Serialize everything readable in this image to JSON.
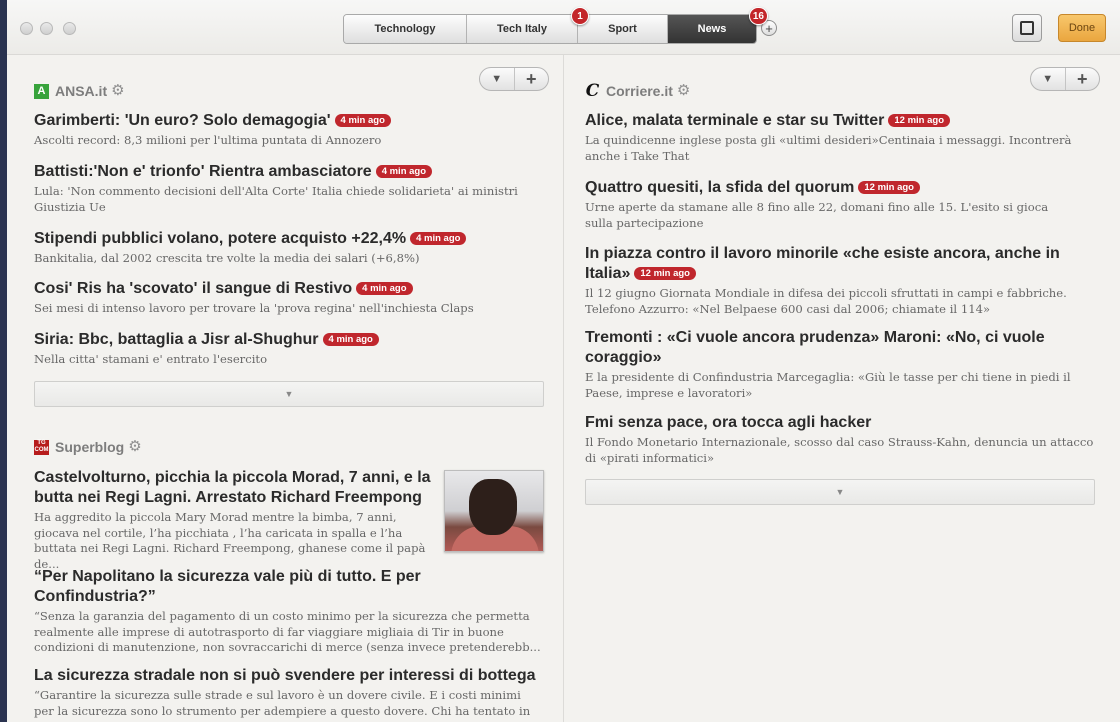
{
  "tabs": [
    {
      "label": "Technology",
      "badge": null,
      "active": false
    },
    {
      "label": "Tech Italy",
      "badge": "1",
      "active": false
    },
    {
      "label": "Sport",
      "badge": null,
      "active": false
    },
    {
      "label": "News",
      "badge": "16",
      "active": true
    }
  ],
  "toolbar": {
    "add_label": "+",
    "done_label": "Done"
  },
  "left": {
    "ansa": {
      "name": "ANSA.it",
      "logo_text": "A",
      "articles": [
        {
          "headline": "Garimberti: 'Un euro? Solo demagogia'",
          "badge": "4 min ago",
          "summary": "Ascolti record: 8,3 milioni per l'ultima puntata di Annozero"
        },
        {
          "headline": "Battisti:'Non e' trionfo' Rientra ambasciatore",
          "badge": "4 min ago",
          "summary": "Lula: 'Non commento decisioni dell'Alta Corte' Italia chiede solidarieta' ai ministri Giustizia Ue"
        },
        {
          "headline": "Stipendi pubblici volano, potere acquisto +22,4%",
          "badge": "4 min ago",
          "summary": "Bankitalia, dal 2002 crescita tre volte la media dei salari (+6,8%)"
        },
        {
          "headline": "Cosi' Ris ha 'scovato' il sangue di Restivo",
          "badge": "4 min ago",
          "summary": "Sei mesi di intenso lavoro per trovare la 'prova regina' nell'inchiesta Claps"
        },
        {
          "headline": "Siria: Bbc, battaglia a Jisr al-Shughur",
          "badge": "4 min ago",
          "summary": "Nella citta' stamani e' entrato l'esercito"
        }
      ]
    },
    "superblog": {
      "name": "Superblog",
      "logo_text": "TG COM",
      "articles": [
        {
          "headline": "Castelvolturno, picchia la piccola Morad, 7 anni, e la butta nei Regi Lagni. Arrestato Richard Freempong",
          "summary": "Ha aggredito la piccola Mary Morad mentre la bimba, 7 anni, giocava nel cortile, l’ha picchiata , l’ha caricata in spalla e l’ha buttata nei Regi Lagni.  Richard Freempong, ghanese come il papà de..."
        },
        {
          "headline": "“Per Napolitano la sicurezza vale più di tutto. E per Confindustria?”",
          "summary": "“Senza la garanzia del pagamento di un costo minimo per la sicurezza che permetta realmente alle imprese di autotrasporto di far viaggiare migliaia di Tir in buone condizioni di manutenzione, non sovraccarichi di merce (senza invece pretenderebb..."
        },
        {
          "headline": "La sicurezza stradale non si può svendere per interessi di bottega",
          "summary": "“Garantire la sicurezza sulle strade e sul lavoro è un dovere civile. E i costi minimi per la sicurezza sono lo strumento per adempiere a questo dovere. Chi ha tentato in ogni"
        }
      ]
    }
  },
  "right": {
    "corriere": {
      "name": "Corriere.it",
      "logo_text": "C",
      "articles": [
        {
          "headline": "Alice, malata terminale e star su Twitter",
          "badge": "12 min ago",
          "summary": "La quindicenne inglese posta gli «ultimi desideri»Centinaia i messaggi. Incontrerà anche i Take That"
        },
        {
          "headline": "Quattro quesiti, la sfida del quorum",
          "badge": "12 min ago",
          "summary": "Urne aperte da stamane alle 8 fino alle 22, domani fino alle 15. L'esito si gioca sulla partecipazione"
        },
        {
          "headline": "In piazza contro il lavoro minorile «che esiste ancora, anche in Italia»",
          "badge": "12 min ago",
          "summary": "Il 12 giugno Giornata Mondiale in difesa dei piccoli sfruttati in campi e fabbriche. Telefono Azzurro: «Nel Belpaese 600 casi dal 2006; chiamate il 114»"
        },
        {
          "headline": "Tremonti : «Ci vuole ancora prudenza» Maroni: «No, ci vuole coraggio»",
          "badge": null,
          "summary": "E la presidente di Confindustria Marcegaglia: «Giù le tasse per chi tiene in piedi il Paese, imprese e lavoratori»"
        },
        {
          "headline": "Fmi senza pace, ora tocca agli hacker",
          "badge": null,
          "summary": "Il Fondo Monetario Internazionale, scosso dal caso Strauss-Kahn, denuncia un attacco di «pirati informatici»"
        }
      ]
    }
  },
  "icons": {
    "gear": "gear-icon",
    "dropdown": "chevron-down-icon",
    "add": "plus-icon"
  },
  "colors": {
    "badge": "#c0272d",
    "done": "#eaa63f",
    "active_tab": "#333333"
  }
}
